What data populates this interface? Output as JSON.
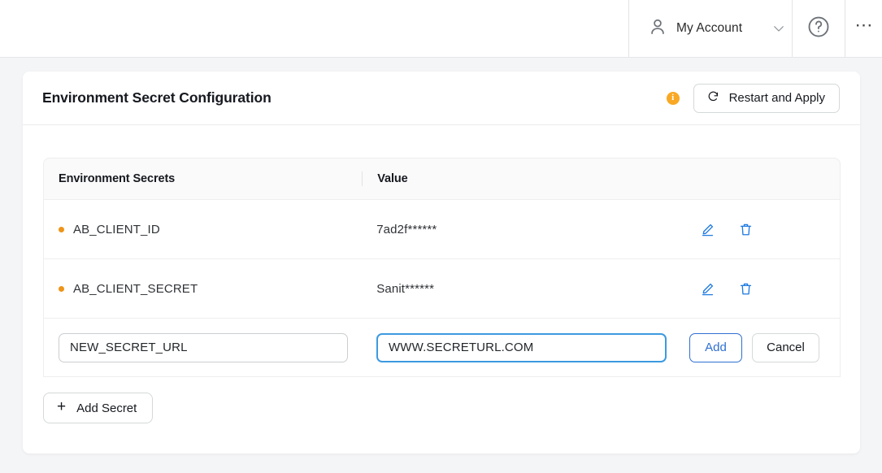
{
  "topbar": {
    "account_label": "My Account",
    "account_icon": "user-icon",
    "chevron_icon": "chevron-down-icon",
    "help_icon": "help-circle-icon",
    "more_icon": "ellipsis-icon"
  },
  "card": {
    "title": "Environment Secret Configuration",
    "info_icon": "info-circle-icon",
    "info_icon_color": "#f9a825",
    "restart_button": {
      "label": "Restart and Apply",
      "icon": "refresh-icon"
    }
  },
  "table": {
    "columns": [
      "Environment Secrets",
      "Value",
      ""
    ],
    "rows": [
      {
        "name": "AB_CLIENT_ID",
        "value": "7ad2f******",
        "bullet_color": "#ee9418",
        "edit_icon": "pencil-icon",
        "delete_icon": "trash-icon"
      },
      {
        "name": "AB_CLIENT_SECRET",
        "value": "Sanit******",
        "bullet_color": "#ee9418",
        "edit_icon": "pencil-icon",
        "delete_icon": "trash-icon"
      }
    ],
    "edit_row": {
      "name_value": "NEW_SECRET_URL",
      "name_placeholder": "",
      "value_value": "WWW.SECRETURL.COM",
      "value_placeholder": "",
      "add_label": "Add",
      "cancel_label": "Cancel",
      "focus_color": "#3d9ae0"
    }
  },
  "footer": {
    "add_secret_label": "Add Secret",
    "add_secret_icon": "plus-icon"
  },
  "colors": {
    "page_background": "#f4f5f7",
    "card_background": "#ffffff",
    "accent_blue": "#1f7ae0",
    "link_blue": "#2f6fd0"
  }
}
